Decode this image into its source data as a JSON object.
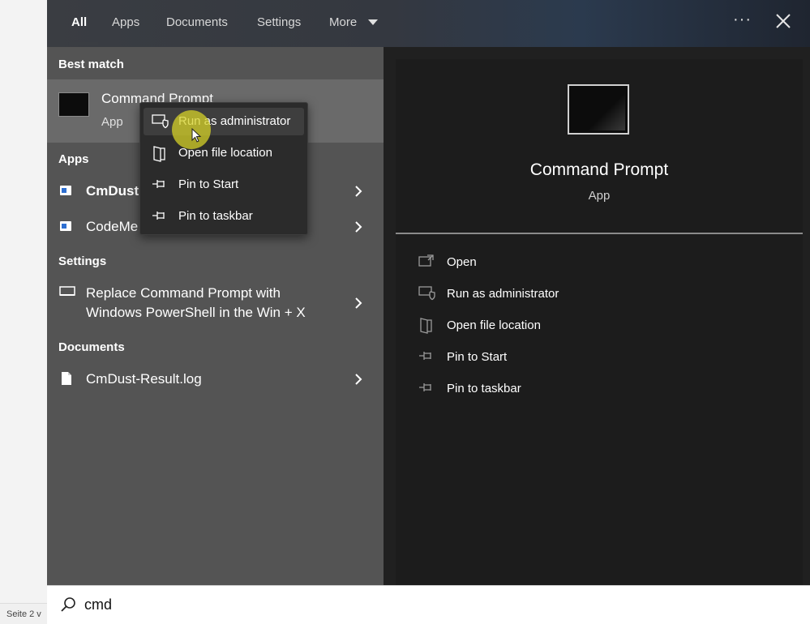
{
  "background": {
    "status_text": "Seite 2 v"
  },
  "tabs": [
    {
      "label": "All"
    },
    {
      "label": "Apps"
    },
    {
      "label": "Documents"
    },
    {
      "label": "Settings"
    },
    {
      "label": "More"
    }
  ],
  "results": {
    "best_match_header": "Best match",
    "best_match": {
      "title": "Command Prompt",
      "subtitle": "App"
    },
    "apps_header": "Apps",
    "apps": [
      {
        "label": "CmDust",
        "bold_prefix": "CmD"
      },
      {
        "label": "CodeMe"
      }
    ],
    "settings_header": "Settings",
    "settings_item": {
      "line1": "Replace Command Prompt with",
      "line2": "Windows PowerShell in the Win + X"
    },
    "documents_header": "Documents",
    "document_item": {
      "label": "CmDust-Result.log"
    }
  },
  "context_menu": {
    "items": [
      {
        "label": "Run as administrator",
        "icon": "shield-window-icon"
      },
      {
        "label": "Open file location",
        "icon": "folder-icon"
      },
      {
        "label": "Pin to Start",
        "icon": "pin-icon"
      },
      {
        "label": "Pin to taskbar",
        "icon": "pin-icon"
      }
    ]
  },
  "preview": {
    "title": "Command Prompt",
    "subtitle": "App",
    "actions": [
      {
        "label": "Open",
        "icon": "open-icon"
      },
      {
        "label": "Run as administrator",
        "icon": "shield-window-icon"
      },
      {
        "label": "Open file location",
        "icon": "folder-icon"
      },
      {
        "label": "Pin to Start",
        "icon": "pin-icon"
      },
      {
        "label": "Pin to taskbar",
        "icon": "pin-icon"
      }
    ]
  },
  "search": {
    "value": "cmd"
  },
  "colors": {
    "panel_bg": "#202020",
    "results_bg": "#545454",
    "highlight": "#d6d228"
  }
}
